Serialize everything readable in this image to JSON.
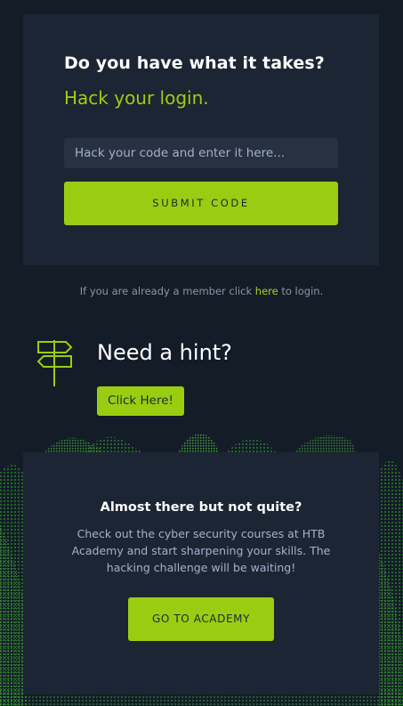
{
  "login_card": {
    "title": "Do you have what it takes?",
    "subtitle": "Hack your login.",
    "input_placeholder": "Hack your code and enter it here...",
    "submit_label": "SUBMIT CODE"
  },
  "member_line": {
    "prefix": "If you are already a member click ",
    "link": "here",
    "suffix": " to login."
  },
  "hint": {
    "icon": "signpost-icon",
    "title": "Need a hint?",
    "button_label": "Click Here!"
  },
  "academy_card": {
    "title": "Almost there but not quite?",
    "text": "Check out the cyber security courses at HTB Academy and start sharpening your skills. The hacking challenge will be waiting!",
    "button_label": "GO TO ACADEMY"
  },
  "colors": {
    "background": "#141c28",
    "card": "#1c2533",
    "accent": "#9acd12",
    "input": "#263142"
  }
}
